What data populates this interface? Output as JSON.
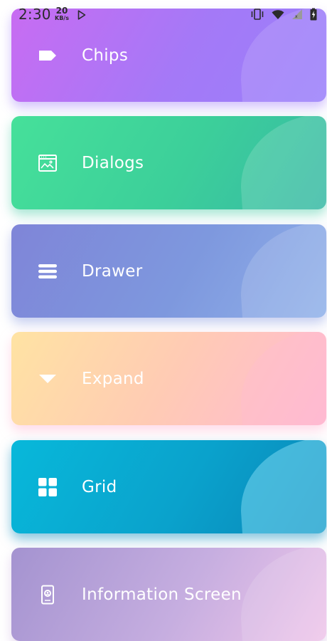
{
  "status_bar": {
    "time": "2:30",
    "net_speed_value": "20",
    "net_speed_unit": "KB/s",
    "icons": [
      "play-store-icon",
      "vibrate-icon",
      "wifi-icon",
      "cell-signal-icon",
      "battery-icon"
    ]
  },
  "menu": {
    "items": [
      {
        "label": "Chips",
        "icon": "label-tag-icon",
        "accent": "#b274f5"
      },
      {
        "label": "Dialogs",
        "icon": "browser-window-icon",
        "accent": "#3fd29a"
      },
      {
        "label": "Drawer",
        "icon": "menu-lines-icon",
        "accent": "#7f90dc"
      },
      {
        "label": "Expand",
        "icon": "dropdown-triangle-icon",
        "accent": "#ffcbb8"
      },
      {
        "label": "Grid",
        "icon": "grid-icon",
        "accent": "#09a0cc"
      },
      {
        "label": "Information Screen",
        "icon": "phone-screen-icon",
        "accent": "#c6aee0"
      }
    ]
  }
}
